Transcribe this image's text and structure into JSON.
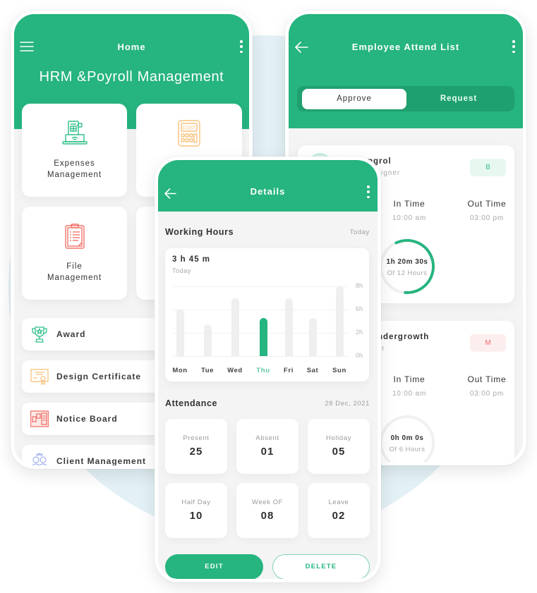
{
  "colors": {
    "brand_green": "#26b47f",
    "segment_dark_green": "#1fa06f",
    "background_circle": "#e3f1f6",
    "badge_b_bg": "#e7f8f0",
    "badge_m_bg": "#fdeeee",
    "badge_m_text": "#ef6a6a"
  },
  "home": {
    "title": "Home",
    "app_title": "HRM &Poyroll Management",
    "menu_icon": "hamburger-menu-icon",
    "more_icon": "kebab-menu-icon",
    "tiles": [
      {
        "line1": "Expenses",
        "line2": "Management",
        "icon": "expenses-laptop-icon"
      },
      {
        "line1": "",
        "line2": "",
        "icon": "cost-calculator-icon"
      },
      {
        "line1": "File",
        "line2": "Management",
        "icon": "file-clipboard-icon"
      },
      {
        "line1": "",
        "line2": "",
        "icon": ""
      }
    ],
    "list": [
      {
        "label": "Award",
        "icon": "trophy-icon"
      },
      {
        "label": "Design Certificate",
        "icon": "certificate-icon"
      },
      {
        "label": "Notice Board",
        "icon": "notice-board-icon"
      },
      {
        "label": "Client Management",
        "icon": "clients-icon"
      }
    ]
  },
  "details": {
    "title": "Details",
    "back_icon": "back-arrow-icon",
    "more_icon": "kebab-menu-icon",
    "working_hours": {
      "heading": "Working Hours",
      "period": "Today",
      "total": "3 h 45 m",
      "total_caption": "Today"
    },
    "attendance": {
      "heading": "Attendance",
      "date": "28 Dec, 2021",
      "stats": [
        {
          "label": "Present",
          "value": "25"
        },
        {
          "label": "Absent",
          "value": "01"
        },
        {
          "label": "Holiday",
          "value": "05"
        },
        {
          "label": "Half Day",
          "value": "10"
        },
        {
          "label": "Week OF",
          "value": "08"
        },
        {
          "label": "Leave",
          "value": "02"
        }
      ]
    },
    "buttons": {
      "edit": "EDIT",
      "delete": "DELETE"
    }
  },
  "attend_list": {
    "title": "Employee Attend List",
    "back_icon": "back-arrow-icon",
    "more_icon": "kebab-menu-icon",
    "tabs": [
      {
        "label": "Approve",
        "active": true
      },
      {
        "label": "Request",
        "active": false
      }
    ],
    "employees": [
      {
        "name_visible": "ngrol",
        "role_visible": "igner",
        "badge": "B",
        "in_label": "In Time",
        "in_time": "10:00 am",
        "out_label": "Out Time",
        "out_time": "03:00 pm",
        "elapsed": "1h 20m 30s",
        "of_hours": "Of 12 Hours",
        "ring_progress": 0.58
      },
      {
        "name_visible": "ndergrowth",
        "role_visible": "ner",
        "badge": "M",
        "in_label": "In Time",
        "in_time": "10:00 am",
        "out_label": "Out Time",
        "out_time": "03:00 pm",
        "elapsed": "0h 0m 0s",
        "of_hours": "Of 6 Hours",
        "ring_progress": 0
      }
    ]
  },
  "chart_data": {
    "type": "bar",
    "title": "Working Hours",
    "categories": [
      "Mon",
      "Tue",
      "Wed",
      "Thu",
      "Fri",
      "Sat",
      "Sun"
    ],
    "values": [
      6,
      3.5,
      7,
      4.5,
      7,
      4.5,
      8
    ],
    "highlight": "Thu",
    "yticks": [
      0,
      2,
      6,
      8
    ],
    "ytick_labels": [
      "0h",
      "2h",
      "6h",
      "8h"
    ],
    "ylim": [
      0,
      8
    ],
    "xlabel": "",
    "ylabel": "",
    "grid": true,
    "yaxis_side": "right"
  }
}
